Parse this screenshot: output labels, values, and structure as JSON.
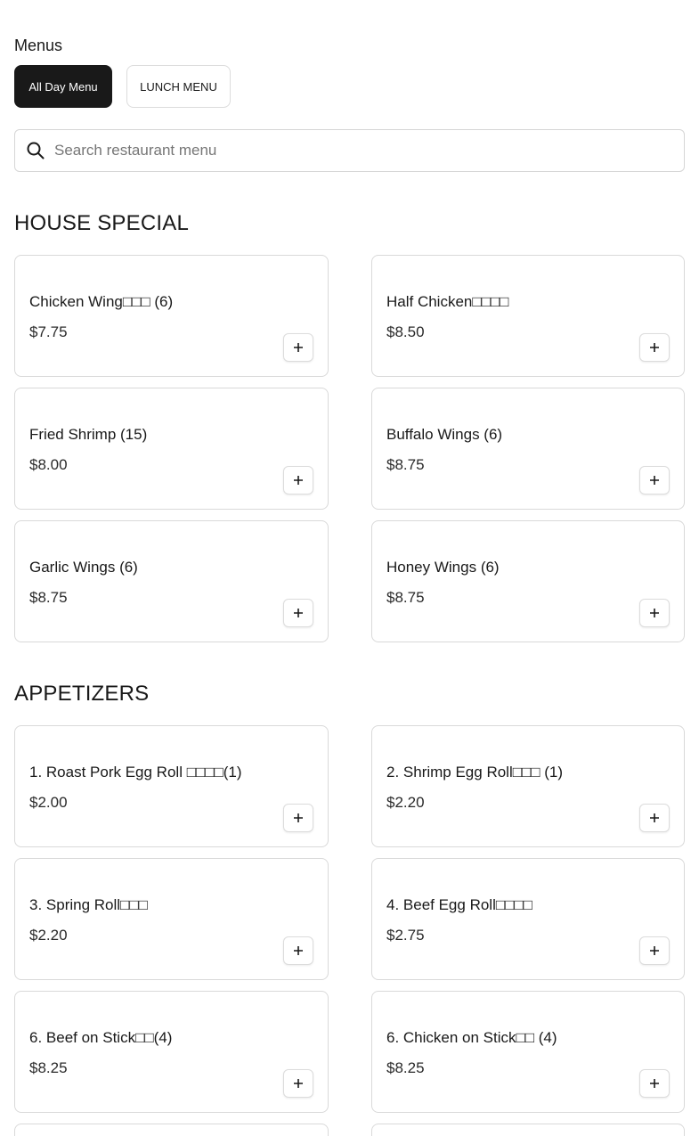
{
  "menus_label": "Menus",
  "menu_tabs": [
    {
      "label": "All Day Menu",
      "active": true
    },
    {
      "label": "LUNCH MENU",
      "active": false
    }
  ],
  "search": {
    "placeholder": "Search restaurant menu"
  },
  "sections": [
    {
      "title": "HOUSE SPECIAL",
      "items": [
        {
          "name": "Chicken Wing□□□ (6)",
          "price": "$7.75"
        },
        {
          "name": "Half Chicken□□□□",
          "price": "$8.50"
        },
        {
          "name": "Fried Shrimp (15)",
          "price": "$8.00"
        },
        {
          "name": "Buffalo Wings (6)",
          "price": "$8.75"
        },
        {
          "name": "Garlic Wings (6)",
          "price": "$8.75"
        },
        {
          "name": "Honey Wings (6)",
          "price": "$8.75"
        }
      ]
    },
    {
      "title": "APPETIZERS",
      "items": [
        {
          "name": "1. Roast Pork Egg Roll □□□□(1)",
          "price": "$2.00"
        },
        {
          "name": "2. Shrimp Egg Roll□□□ (1)",
          "price": "$2.20"
        },
        {
          "name": "3. Spring Roll□□□",
          "price": "$2.20"
        },
        {
          "name": "4. Beef Egg Roll□□□□",
          "price": "$2.75"
        },
        {
          "name": "6. Beef on Stick□□(4)",
          "price": "$8.25"
        },
        {
          "name": "6. Chicken on Stick□□ (4)",
          "price": "$8.25"
        }
      ]
    }
  ]
}
